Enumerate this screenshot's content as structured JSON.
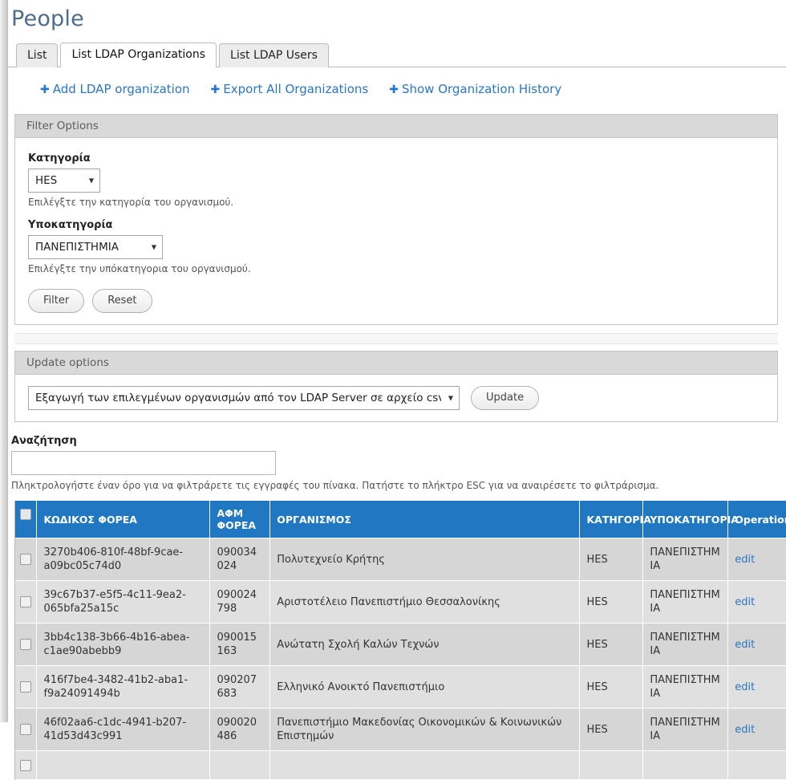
{
  "page": {
    "title": "People"
  },
  "tabs": [
    {
      "label": "List",
      "active": false
    },
    {
      "label": "List LDAP Organizations",
      "active": true
    },
    {
      "label": "List LDAP Users",
      "active": false
    }
  ],
  "actions": [
    {
      "icon": "plus-icon",
      "label": "Add LDAP organization"
    },
    {
      "icon": "plus-icon",
      "label": "Export All Organizations"
    },
    {
      "icon": "plus-icon",
      "label": "Show Organization History"
    }
  ],
  "filter_options": {
    "legend": "Filter Options",
    "category": {
      "label": "Κατηγορία",
      "value": "HES",
      "options": [
        "HES"
      ],
      "description": "Επιλέγξτε την κατηγορία του οργανισμού."
    },
    "subcategory": {
      "label": "Υποκατηγορία",
      "value": "ΠΑΝΕΠΙΣΤΗΜΙΑ",
      "options": [
        "ΠΑΝΕΠΙΣΤΗΜΙΑ"
      ],
      "description": "Επιλέγξτε την υπόκατηγορια του οργανισμού."
    },
    "filter_button": "Filter",
    "reset_button": "Reset"
  },
  "update_options": {
    "legend": "Update options",
    "action": {
      "value": "Εξαγωγή των επιλεγμένων οργανισμών από τον LDAP Server σε αρχείο csv",
      "options": [
        "Εξαγωγή των επιλεγμένων οργανισμών από τον LDAP Server σε αρχείο csv"
      ]
    },
    "update_button": "Update"
  },
  "search": {
    "label": "Αναζήτηση",
    "value": "",
    "placeholder": "",
    "description": "Πληκτρολογήστε έναν όρο για να φιλτράρετε τις εγγραφές του πίνακα. Πατήστε το πλήκτρο ESC για να αναιρέσετε το φιλτράρισμα."
  },
  "table": {
    "columns": [
      {
        "key": "select",
        "label": ""
      },
      {
        "key": "code",
        "label": "ΚΩΔΙΚΟΣ ΦΟΡΕΑ"
      },
      {
        "key": "afm",
        "label": "ΑΦΜ ΦΟΡΕΑ"
      },
      {
        "key": "org",
        "label": "ΟΡΓΑΝΙΣΜΟΣ"
      },
      {
        "key": "cat",
        "label": "ΚΑΤΗΓΟΡΙΑ"
      },
      {
        "key": "subcat",
        "label": "ΥΠΟΚΑΤΗΓΟΡΙΑ"
      },
      {
        "key": "op",
        "label": "Operations"
      }
    ],
    "rows": [
      {
        "selected": false,
        "code": "3270b406-810f-48bf-9cae-a09bc05c74d0",
        "afm": "090034024",
        "org": "Πολυτεχνείο Κρήτης",
        "cat": "HES",
        "subcat": "ΠΑΝΕΠΙΣΤΗΜΙΑ",
        "op": "edit"
      },
      {
        "selected": false,
        "code": "39c67b37-e5f5-4c11-9ea2-065bfa25a15c",
        "afm": "090024798",
        "org": "Αριστοτέλειο Πανεπιστήμιο Θεσσαλονίκης",
        "cat": "HES",
        "subcat": "ΠΑΝΕΠΙΣΤΗΜΙΑ",
        "op": "edit"
      },
      {
        "selected": false,
        "code": "3bb4c138-3b66-4b16-abea-c1ae90abebb9",
        "afm": "090015163",
        "org": "Ανώτατη Σχολή Καλών Τεχνών",
        "cat": "HES",
        "subcat": "ΠΑΝΕΠΙΣΤΗΜΙΑ",
        "op": "edit"
      },
      {
        "selected": false,
        "code": "416f7be4-3482-41b2-aba1-f9a24091494b",
        "afm": "090207683",
        "org": "Ελληνικό Ανοικτό Πανεπιστήμιο",
        "cat": "HES",
        "subcat": "ΠΑΝΕΠΙΣΤΗΜΙΑ",
        "op": "edit"
      },
      {
        "selected": false,
        "code": "46f02aa6-c1dc-4941-b207-41d53d43c991",
        "afm": "090020486",
        "org": "Πανεπιστήμιο Μακεδονίας Οικονομικών & Κοινωνικών Επιστημών",
        "cat": "HES",
        "subcat": "ΠΑΝΕΠΙΣΤΗΜΙΑ",
        "op": "edit"
      },
      {
        "selected": false,
        "code": "",
        "afm": "",
        "org": "",
        "cat": "",
        "subcat": "",
        "op": ""
      }
    ]
  },
  "colors": {
    "header_blue": "#1f78c1",
    "link_blue": "#2a76c6",
    "title_blue": "#4e6d8c",
    "row_odd": "#d6d6d6",
    "row_even": "#e0e0e0",
    "legend_gray": "#d9d9d9"
  }
}
